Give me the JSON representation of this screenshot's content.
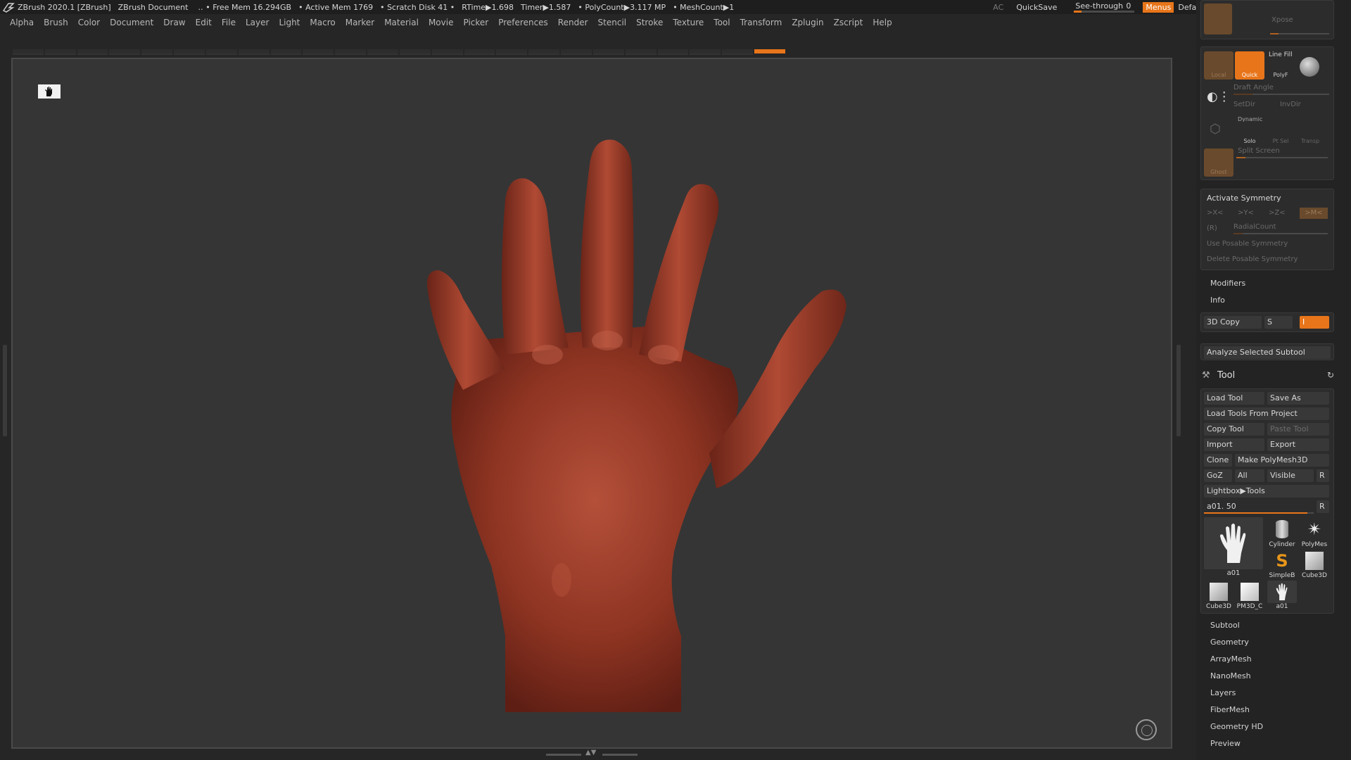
{
  "titlebar": {
    "app_title": "ZBrush 2020.1 [ZBrush]",
    "document": "ZBrush Document",
    "free_mem": "‥ • Free Mem 16.294GB",
    "active_mem": "• Active Mem 1769",
    "scratch_disk": "• Scratch Disk 41 •",
    "rtime": "RTime▶1.698",
    "timer": "Timer▶1.587",
    "polycount": "• PolyCount▶3.117 MP",
    "meshcount": "• MeshCount▶1",
    "ac": "AC",
    "quicksave": "QuickSave",
    "see_through_label": "See-through",
    "see_through_value": "0",
    "see_through_level": 0.0,
    "menus": "Menus",
    "script": "DefaultZScript"
  },
  "menubar": [
    "Alpha",
    "Brush",
    "Color",
    "Document",
    "Draw",
    "Edit",
    "File",
    "Layer",
    "Light",
    "Macro",
    "Marker",
    "Material",
    "Movie",
    "Picker",
    "Preferences",
    "Render",
    "Stencil",
    "Stroke",
    "Texture",
    "Tool",
    "Transform",
    "Zplugin",
    "Zscript",
    "Help"
  ],
  "transform_panel": {
    "xpose": "Xpose",
    "local": "Local",
    "quick": "Quick",
    "line_fill": "Line Fill",
    "polyf": "PolyF",
    "draft_angle": "Draft Angle",
    "setdir": "SetDir",
    "invdir": "InvDir",
    "dynamic": "Dynamic",
    "solo": "Solo",
    "pt_sel": "Pt Sel",
    "transp": "Transp",
    "ghost": "Ghost",
    "split_screen": "Split Screen"
  },
  "symmetry": {
    "activate": "Activate Symmetry",
    "x": ">X<",
    "y": ">Y<",
    "z": ">Z<",
    "m": ">M<",
    "r": "(R)",
    "radial": "RadialCount",
    "use_posable": "Use Posable Symmetry",
    "delete_posable": "Delete Posable Symmetry"
  },
  "modifiers": "Modifiers",
  "info": "Info",
  "copy3d": {
    "label": "3D Copy",
    "s": "S",
    "i": "I"
  },
  "analyze": "Analyze Selected Subtool",
  "tool": {
    "title": "Tool",
    "load_tool": "Load Tool",
    "save_as": "Save As",
    "load_from_project": "Load Tools From Project",
    "copy_tool": "Copy Tool",
    "paste_tool": "Paste Tool",
    "import": "Import",
    "export": "Export",
    "clone": "Clone",
    "make_polymesh": "Make PolyMesh3D",
    "goz": "GoZ",
    "all": "All",
    "visible": "Visible",
    "r": "R",
    "lightbox": "Lightbox▶Tools",
    "current": "a01. 50",
    "thumbs": [
      "a01",
      "Cylinder",
      "PolyMes",
      "SimpleB",
      "Cube3D",
      "Cube3D",
      "PM3D_C",
      "a01"
    ]
  },
  "tool_sections": [
    "Subtool",
    "Geometry",
    "ArrayMesh",
    "NanoMesh",
    "Layers",
    "FiberMesh",
    "Geometry HD",
    "Preview"
  ],
  "colors": {
    "accent": "#e8751a",
    "background": "#262626",
    "canvas": "#353535",
    "model": "#9a3826"
  },
  "icons": [
    "zbrush-logo-icon",
    "hand-icon",
    "gyro-icon",
    "tool-icon",
    "refresh-icon"
  ]
}
